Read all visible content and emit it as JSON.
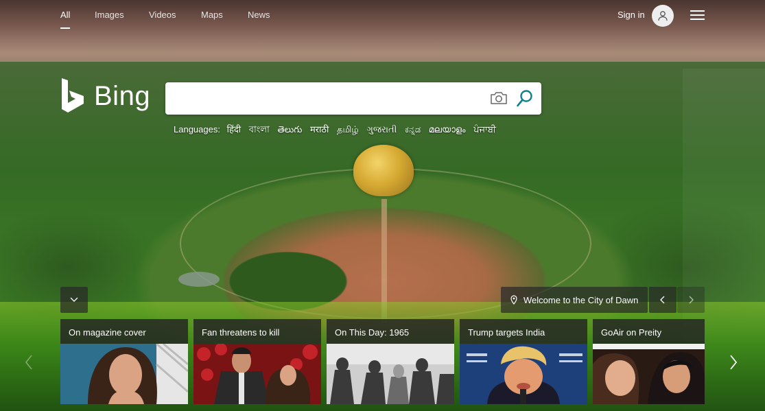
{
  "nav": {
    "tabs": [
      {
        "label": "All",
        "active": true
      },
      {
        "label": "Images",
        "active": false
      },
      {
        "label": "Videos",
        "active": false
      },
      {
        "label": "Maps",
        "active": false
      },
      {
        "label": "News",
        "active": false
      }
    ],
    "sign_in_label": "Sign in"
  },
  "logo": {
    "text": "Bing"
  },
  "search": {
    "value": "",
    "placeholder": ""
  },
  "languages": {
    "label": "Languages:",
    "items": [
      "हिंदी",
      "বাংলা",
      "తెలుగు",
      "मराठी",
      "தமிழ்",
      "ગુજરાતી",
      "ಕನ್ನಡ",
      "മലയാളം",
      "ਪੰਜਾਬੀ"
    ]
  },
  "image_caption": "Welcome to the City of Dawn",
  "cards": [
    {
      "title": "On magazine cover"
    },
    {
      "title": "Fan threatens to kill"
    },
    {
      "title": "On This Day: 1965"
    },
    {
      "title": "Trump targets India"
    },
    {
      "title": "GoAir on Preity"
    }
  ],
  "colors": {
    "accent": "#0f7f8f",
    "card_bg": "#232323"
  }
}
